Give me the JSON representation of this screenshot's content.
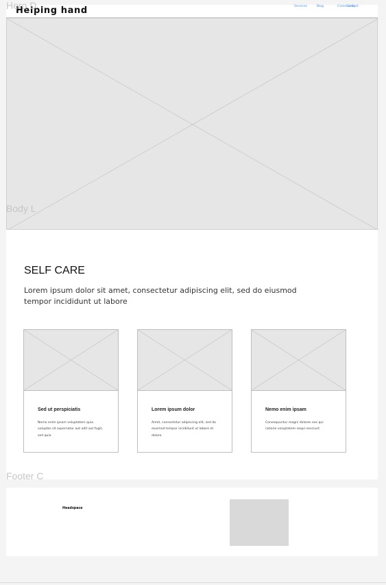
{
  "frames": {
    "hero_label": "Hero D",
    "body_label": "Body L",
    "footer_label": "Footer C"
  },
  "nav": {
    "brand": "Helping hand",
    "links": [
      "Services",
      "Blog",
      "Community",
      "Contact"
    ]
  },
  "section": {
    "title": "SELF CARE",
    "lead": "Lorem ipsum dolor sit amet, consectetur adipiscing elit, sed do eiusmod tempor incididunt ut labore"
  },
  "cards": [
    {
      "title": "Sed ut perspiciatis",
      "text": "Nemo enim ipsam voluptatem quia voluptas sit aspernatur aut odit aut fugit, sed quia"
    },
    {
      "title": "Lorem ipsum dolor",
      "text": "Amet, consectetur adipiscing elit, sed do eiusmod tempor incididunt ut labore et dolore."
    },
    {
      "title": "Nemo enim ipsam",
      "text": "Consequuntur magni dolores eos qui ratione voluptatem sequi nesciunt."
    }
  ],
  "footer": {
    "text": "Headspace"
  },
  "colors": {
    "placeholder": "#e6e6e6",
    "nav_link": "#4a90e2"
  }
}
